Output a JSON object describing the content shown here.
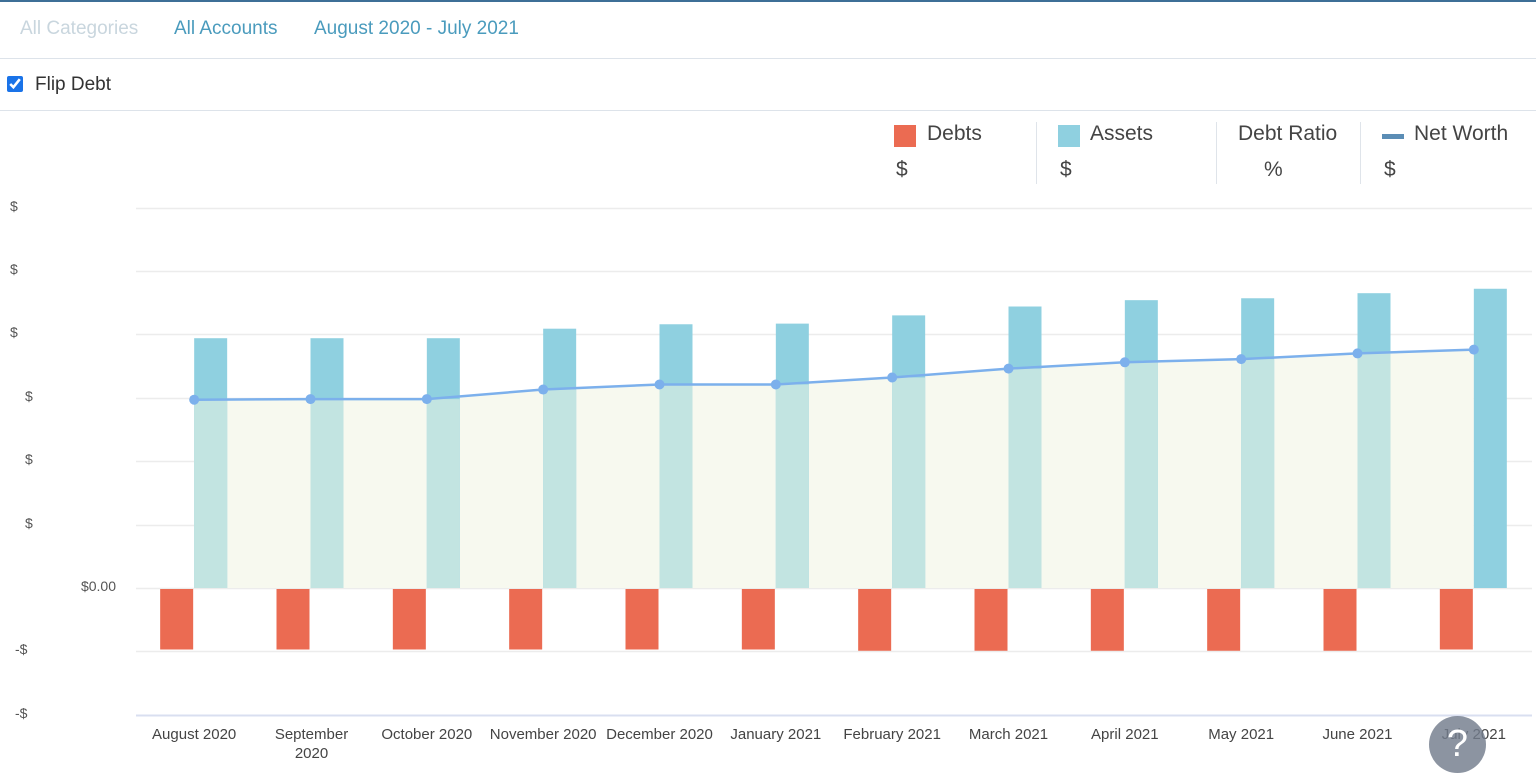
{
  "filters": {
    "categories": "All Categories",
    "accounts": "All Accounts",
    "date_range": "August 2020 - July 2021"
  },
  "options": {
    "flip_debt_label": "Flip Debt",
    "flip_debt_checked": true
  },
  "legend": {
    "debts": {
      "label": "Debts",
      "value": "$",
      "color": "#eb6b52"
    },
    "assets": {
      "label": "Assets",
      "value": "$",
      "color": "#8fd0e0"
    },
    "debt_ratio": {
      "label": "Debt Ratio",
      "value": "%"
    },
    "net_worth": {
      "label": "Net Worth",
      "value": "$",
      "color": "#5b8db5"
    }
  },
  "help_button": {
    "label": "?"
  },
  "chart_data": {
    "type": "bar",
    "title": "",
    "xlabel": "",
    "ylabel": "",
    "units_note": "Y-axis value labels are redacted; values are expressed in gridline steps (1 step per gridline above/below $0.00)",
    "categories": [
      "August 2020",
      "September 2020",
      "October 2020",
      "November 2020",
      "December 2020",
      "January 2021",
      "February 2021",
      "March 2021",
      "April 2021",
      "May 2021",
      "June 2021",
      "July 2021"
    ],
    "y_tick_labels": [
      "-$",
      "-$",
      "$0.00",
      "$",
      "$",
      "$",
      "$",
      "$",
      "$"
    ],
    "y_ticks": [
      -2,
      -1,
      0,
      1,
      2,
      3,
      4,
      5,
      6
    ],
    "ylim": [
      -2,
      6
    ],
    "grid": true,
    "legend_position": "top-right",
    "series": [
      {
        "name": "Debts",
        "type": "bar",
        "color": "#eb6b52",
        "values": [
          -0.97,
          -0.97,
          -0.97,
          -0.97,
          -0.97,
          -0.97,
          -0.99,
          -0.99,
          -0.99,
          -0.99,
          -0.99,
          -0.97
        ]
      },
      {
        "name": "Assets",
        "type": "bar",
        "color": "#8fd0e0",
        "values": [
          3.94,
          3.94,
          3.94,
          4.09,
          4.16,
          4.17,
          4.3,
          4.44,
          4.54,
          4.57,
          4.65,
          4.72
        ]
      },
      {
        "name": "Net Worth",
        "type": "line-area",
        "color": "#7cb0ec",
        "fill": "#f7f9ef",
        "values": [
          2.97,
          2.98,
          2.98,
          3.13,
          3.21,
          3.21,
          3.32,
          3.46,
          3.56,
          3.61,
          3.7,
          3.76
        ]
      }
    ]
  }
}
